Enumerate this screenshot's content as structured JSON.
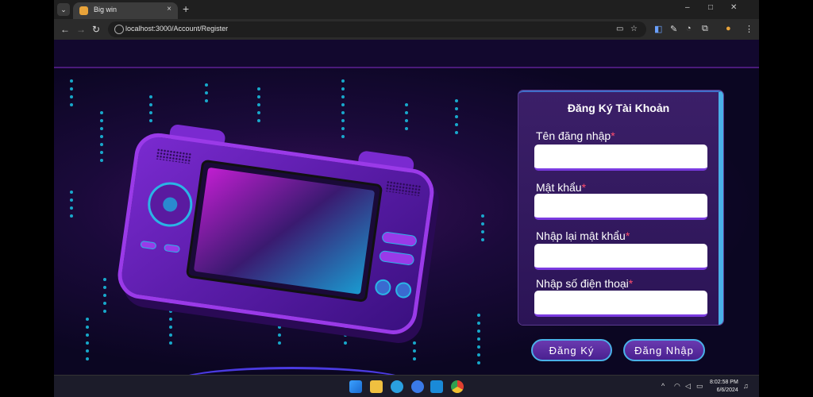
{
  "browser": {
    "tab_title": "Big win",
    "url": "localhost:3000/Account/Register",
    "new_tab": "+",
    "close": "×",
    "minimize": "–",
    "maximize": "□",
    "window_close": "✕",
    "icons": [
      "back-icon",
      "forward-icon",
      "reload-icon",
      "site-info-icon",
      "cast-icon",
      "bookmark-star-icon",
      "extensions-icon",
      "profile-icon",
      "menu-icon"
    ]
  },
  "form": {
    "title": "Đăng Ký Tài Khoản",
    "fields": [
      {
        "label": "Tên đăng nhập",
        "required": "*",
        "value": ""
      },
      {
        "label": "Mật khẩu",
        "required": "*",
        "value": ""
      },
      {
        "label": "Nhập lại mật khẩu",
        "required": "*",
        "value": ""
      },
      {
        "label": "Nhập số điện thoại",
        "required": "*",
        "value": ""
      }
    ],
    "register_button": "Đăng Ký",
    "login_button": "Đăng Nhập"
  },
  "taskbar": {
    "apps": [
      "windows-start-icon",
      "file-explorer-icon",
      "telegram-icon",
      "azure-data-studio-icon",
      "vscode-icon",
      "chrome-icon"
    ],
    "time": "8:02:58 PM",
    "date": "6/6/2024"
  },
  "colors": {
    "accent": "#4ab0e8",
    "form_bg": "#3b1f68",
    "required": "#ff4d6d",
    "page_bg": "#0b0622"
  }
}
